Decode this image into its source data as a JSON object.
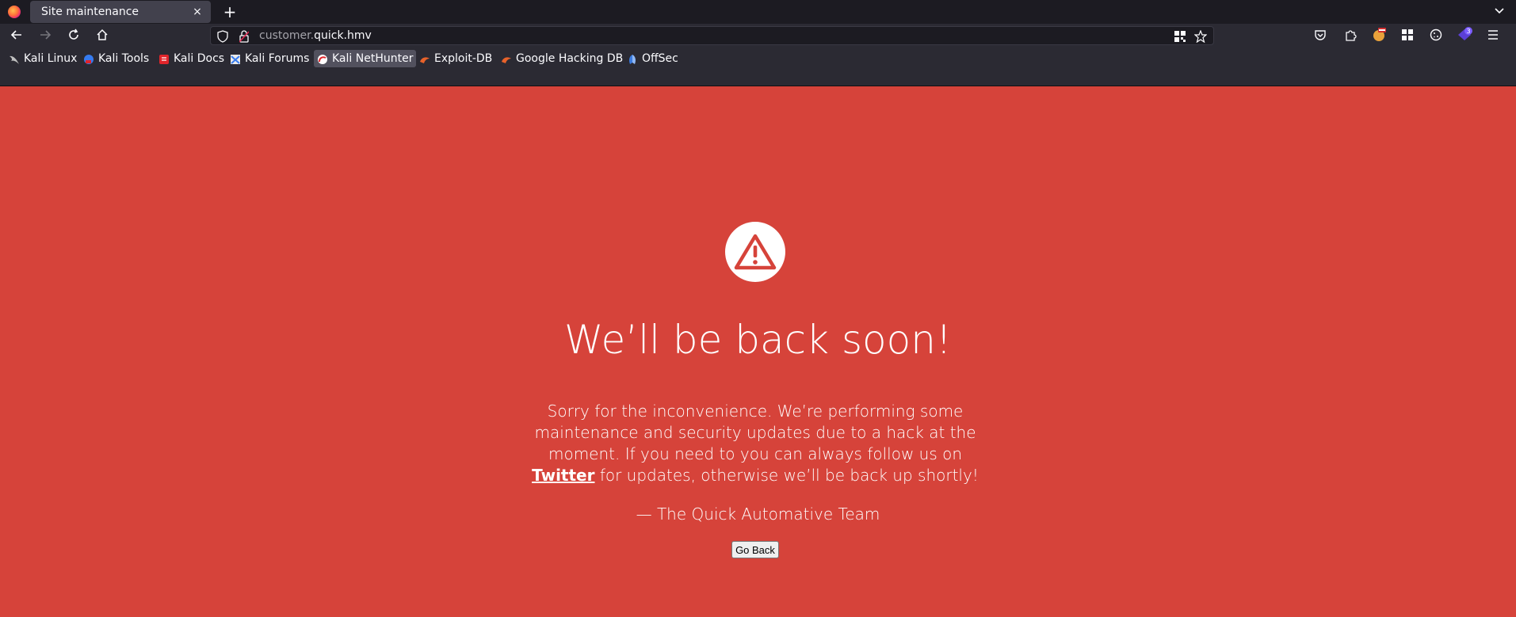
{
  "browser": {
    "tab": {
      "title": "Site maintenance",
      "close_glyph": "×"
    },
    "new_tab_glyph": "+",
    "url": {
      "subdomain": "customer.",
      "domain": "quick.hmv"
    },
    "badge_count": "3"
  },
  "bookmarks": [
    {
      "label": "Kali Linux",
      "icon": "kali-dragon-icon",
      "color": "#1a1a1a"
    },
    {
      "label": "Kali Tools",
      "icon": "kali-tools-icon",
      "color": "#367bf0"
    },
    {
      "label": "Kali Docs",
      "icon": "kali-docs-icon",
      "color": "#e0242a"
    },
    {
      "label": "Kali Forums",
      "icon": "kali-forums-icon",
      "color": "#367bf0"
    },
    {
      "label": "Kali NetHunter",
      "icon": "nethunter-icon",
      "color": "#e0242a",
      "active": true
    },
    {
      "label": "Exploit-DB",
      "icon": "exploit-db-icon",
      "color": "#e8622a"
    },
    {
      "label": "Google Hacking DB",
      "icon": "ghdb-icon",
      "color": "#e8622a"
    },
    {
      "label": "OffSec",
      "icon": "offsec-icon",
      "color": "#3b7be0"
    }
  ],
  "page": {
    "headline": "We’ll be back soon!",
    "body_before_link": "Sorry for the inconvenience. We’re performing some maintenance and security updates due to a hack at the moment. If you need to you can always follow us on ",
    "link_text": "Twitter",
    "body_after_link": " for updates, otherwise we’ll be back up shortly!",
    "signature": "— The Quick Automative Team",
    "button_label": "Go Back",
    "background_color": "#d6433a"
  }
}
